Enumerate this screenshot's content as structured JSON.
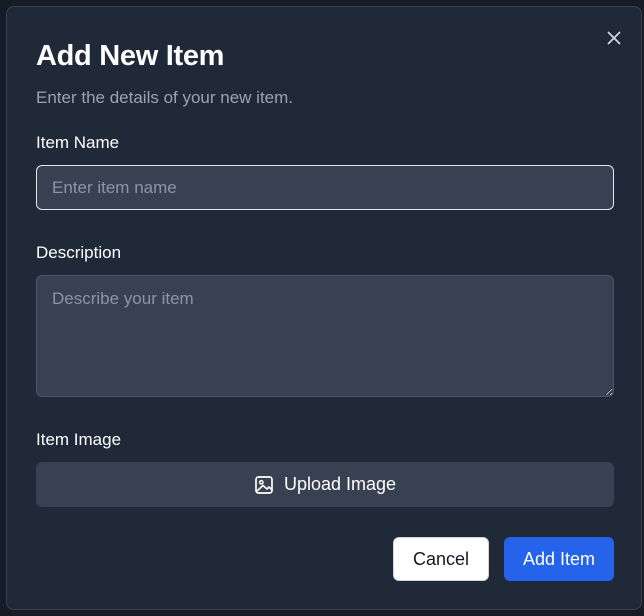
{
  "dialog": {
    "title": "Add New Item",
    "subtitle": "Enter the details of your new item.",
    "close_icon": "close-icon"
  },
  "form": {
    "name": {
      "label": "Item Name",
      "placeholder": "Enter item name",
      "value": ""
    },
    "description": {
      "label": "Description",
      "placeholder": "Describe your item",
      "value": ""
    },
    "image": {
      "label": "Item Image",
      "upload_label": "Upload Image",
      "upload_icon": "image-icon"
    }
  },
  "actions": {
    "cancel_label": "Cancel",
    "submit_label": "Add Item"
  },
  "colors": {
    "dialog_background": "#1f2937",
    "input_background": "#374151",
    "primary_button": "#2563eb",
    "secondary_button": "#ffffff"
  }
}
